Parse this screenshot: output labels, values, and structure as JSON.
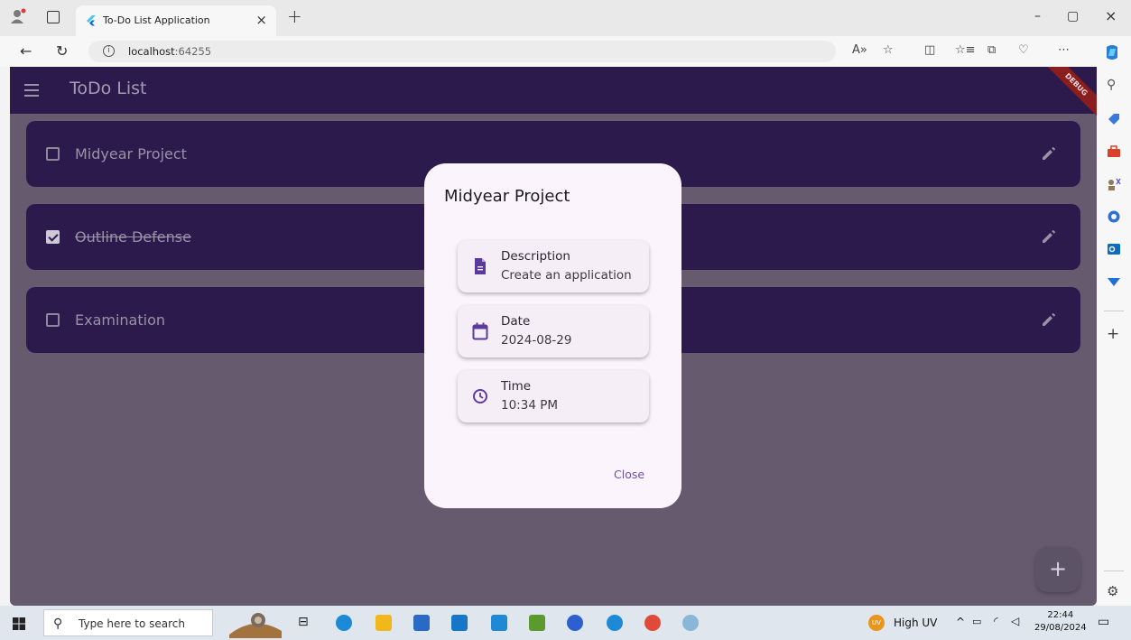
{
  "browser": {
    "tab_title": "To-Do List Application",
    "tab_close": "×",
    "new_tab": "+",
    "url_host": "localhost",
    "url_port": ":64255",
    "info_glyph": "i",
    "minimize": "–",
    "restore": "▢",
    "close": "×",
    "more": "⋯"
  },
  "app": {
    "title": "ToDo List",
    "debug_banner": "DEBUG",
    "primary_color": "#2c1a4d",
    "tasks": [
      {
        "label": "Midyear Project",
        "done": false
      },
      {
        "label": "Outline Defense",
        "done": true
      },
      {
        "label": "Examination",
        "done": false
      }
    ],
    "fab_label": "+"
  },
  "dialog": {
    "title": "Midyear Project",
    "description_label": "Description",
    "description_value": "Create an application",
    "date_label": "Date",
    "date_value": "2024-08-29",
    "time_label": "Time",
    "time_value": "10:34 PM",
    "close_label": "Close",
    "accent_color": "#6b4fb0"
  },
  "taskbar": {
    "search_placeholder": "Type here to search",
    "weather": "High UV",
    "uv_badge": "UV",
    "time": "22:44",
    "date": "29/08/2024"
  }
}
